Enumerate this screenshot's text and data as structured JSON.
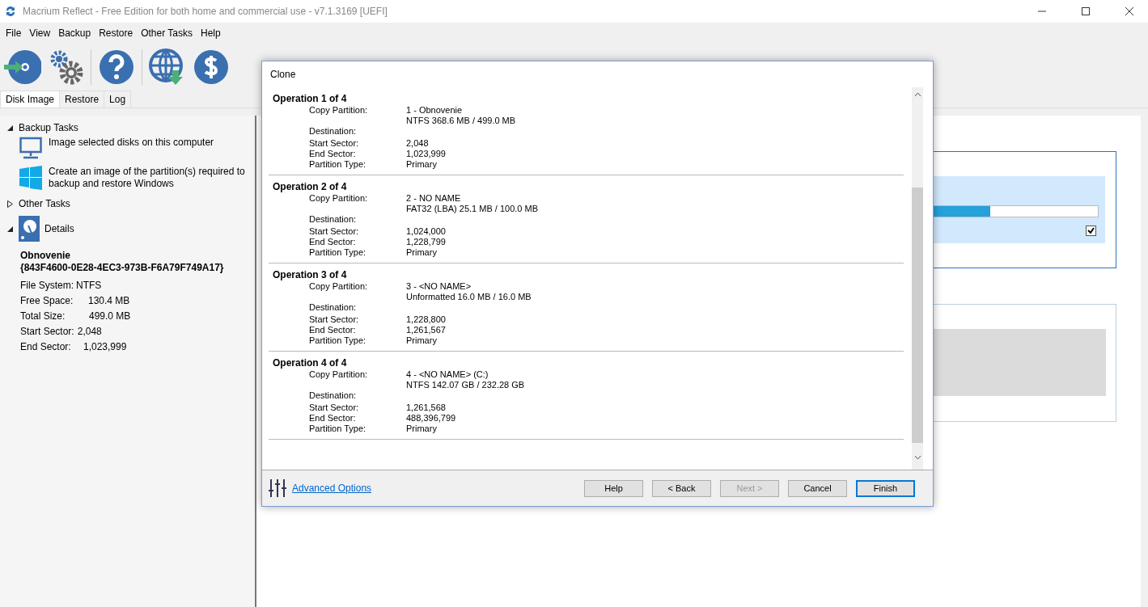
{
  "window": {
    "title": "Macrium Reflect - Free Edition for both home and commercial use - v7.1.3169  [UEFI]"
  },
  "menu": [
    "File",
    "View",
    "Backup",
    "Restore",
    "Other Tasks",
    "Help"
  ],
  "tabs": [
    {
      "label": "Disk Image",
      "selected": true
    },
    {
      "label": "Restore",
      "selected": false
    },
    {
      "label": "Log",
      "selected": false
    }
  ],
  "sidebar": {
    "sections": [
      {
        "title": "Backup Tasks",
        "expanded": true,
        "items": [
          {
            "kind": "monitor",
            "text": "Image selected disks on this computer"
          },
          {
            "kind": "windows",
            "text": "Create an image of the partition(s) required to backup and restore Windows"
          }
        ]
      },
      {
        "title": "Other Tasks",
        "expanded": false
      },
      {
        "title": "Details",
        "expanded": true,
        "kind": "disk"
      }
    ],
    "details": {
      "name": "Obnovenie",
      "guid": "{843F4600-0E28-4EC3-973B-F6A79F749A17}",
      "rows": [
        {
          "label": "File System:",
          "value": "NTFS"
        },
        {
          "label": "Free Space:",
          "value": "130.4 MB"
        },
        {
          "label": "Total Size:",
          "value": "499.0 MB"
        },
        {
          "label": "Start Sector:",
          "value": "2,048"
        },
        {
          "label": "End Sector:",
          "value": "1,023,999"
        }
      ]
    }
  },
  "main": {
    "progress": {
      "level": 0.87
    },
    "checkbox": {
      "checked": true
    }
  },
  "dialog": {
    "title": "Clone",
    "operations": [
      {
        "heading": "Operation 1 of 4",
        "fields": [
          {
            "label": "Copy Partition:",
            "lines": [
              "1 - Obnovenie",
              "NTFS 368.6 MB / 499.0 MB"
            ]
          },
          {
            "label": "Destination:"
          },
          {
            "label": "Start Sector:",
            "lines": [
              "2,048"
            ]
          },
          {
            "label": "End Sector:",
            "lines": [
              "1,023,999"
            ]
          },
          {
            "label": "Partition Type:",
            "lines": [
              "Primary"
            ]
          }
        ]
      },
      {
        "heading": "Operation 2 of 4",
        "fields": [
          {
            "label": "Copy Partition:",
            "lines": [
              "2 - NO NAME",
              "FAT32 (LBA) 25.1 MB / 100.0 MB"
            ]
          },
          {
            "label": "Destination:"
          },
          {
            "label": "Start Sector:",
            "lines": [
              "1,024,000"
            ]
          },
          {
            "label": "End Sector:",
            "lines": [
              "1,228,799"
            ]
          },
          {
            "label": "Partition Type:",
            "lines": [
              "Primary"
            ]
          }
        ]
      },
      {
        "heading": "Operation 3 of 4",
        "fields": [
          {
            "label": "Copy Partition:",
            "lines": [
              "3 - <NO NAME>",
              "Unformatted 16.0 MB / 16.0 MB"
            ]
          },
          {
            "label": "Destination:"
          },
          {
            "label": "Start Sector:",
            "lines": [
              "1,228,800"
            ]
          },
          {
            "label": "End Sector:",
            "lines": [
              "1,261,567"
            ]
          },
          {
            "label": "Partition Type:",
            "lines": [
              "Primary"
            ]
          }
        ]
      },
      {
        "heading": "Operation 4 of 4",
        "fields": [
          {
            "label": "Copy Partition:",
            "lines": [
              "4 - <NO NAME> (C:)",
              "NTFS 142.07 GB / 232.28 GB"
            ]
          },
          {
            "label": "Destination:"
          },
          {
            "label": "Start Sector:",
            "lines": [
              "1,261,568"
            ]
          },
          {
            "label": "End Sector:",
            "lines": [
              "488,396,799"
            ]
          },
          {
            "label": "Partition Type:",
            "lines": [
              "Primary"
            ]
          }
        ]
      }
    ],
    "advanced_link": "Advanced Options",
    "buttons": [
      {
        "label": "Help",
        "disabled": false,
        "default": false
      },
      {
        "label": "< Back",
        "disabled": false,
        "default": false
      },
      {
        "label": "Next >",
        "disabled": true,
        "default": false
      },
      {
        "label": "Cancel",
        "disabled": false,
        "default": false
      },
      {
        "label": "Finish",
        "disabled": false,
        "default": true
      }
    ]
  }
}
